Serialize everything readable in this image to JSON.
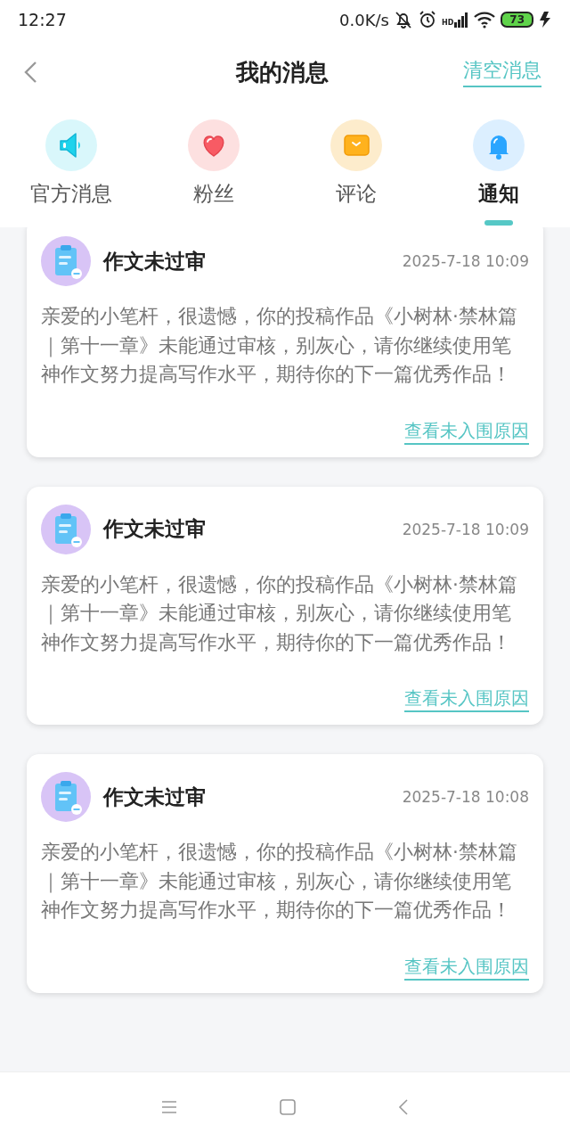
{
  "status_bar": {
    "time": "12:27",
    "net_speed": "0.0K/s",
    "signal_label": "HD",
    "battery": "73"
  },
  "header": {
    "title": "我的消息",
    "action": "清空消息"
  },
  "tabs": [
    {
      "label": "官方消息",
      "selected": false
    },
    {
      "label": "粉丝",
      "selected": false
    },
    {
      "label": "评论",
      "selected": false
    },
    {
      "label": "通知",
      "selected": true
    }
  ],
  "messages": [
    {
      "title": "作文未过审",
      "time": "2025-7-18 10:09",
      "body": "亲爱的小笔杆，很遗憾，你的投稿作品《小树林·禁林篇｜第十一章》未能通过审核，别灰心，请你继续使用笔神作文努力提高写作水平，期待你的下一篇优秀作品！",
      "link": "查看未入围原因"
    },
    {
      "title": "作文未过审",
      "time": "2025-7-18 10:09",
      "body": "亲爱的小笔杆，很遗憾，你的投稿作品《小树林·禁林篇｜第十一章》未能通过审核，别灰心，请你继续使用笔神作文努力提高写作水平，期待你的下一篇优秀作品！",
      "link": "查看未入围原因"
    },
    {
      "title": "作文未过审",
      "time": "2025-7-18 10:08",
      "body": "亲爱的小笔杆，很遗憾，你的投稿作品《小树林·禁林篇｜第十一章》未能通过审核，别灰心，请你继续使用笔神作文努力提高写作水平，期待你的下一篇优秀作品！",
      "link": "查看未入围原因"
    }
  ]
}
